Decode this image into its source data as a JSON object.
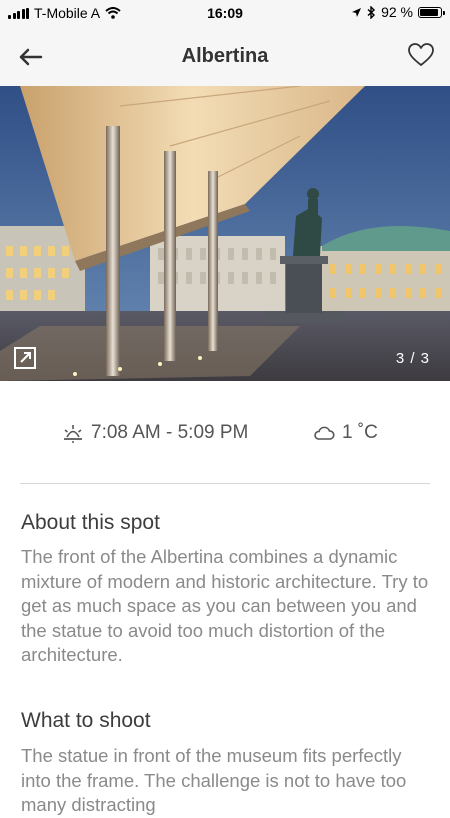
{
  "status_bar": {
    "carrier": "T-Mobile A",
    "time": "16:09",
    "battery": "92 %",
    "battery_level": 0.92
  },
  "nav": {
    "title": "Albertina"
  },
  "photo": {
    "counter": "3 / 3"
  },
  "info": {
    "sun_times": "7:08 AM - 5:09 PM",
    "temperature": "1 ˚C"
  },
  "about": {
    "title": "About this spot",
    "body": "The front of the Albertina combines a dynamic mixture of modern and historic architecture. Try to get as much space as you can between you and the statue to avoid too much distortion of the architecture."
  },
  "shoot": {
    "title": "What to shoot",
    "body": "The statue in front of the museum fits perfectly into the frame. The challenge is not to have too many distracting"
  },
  "colors": {
    "sky": "#3a5a8c",
    "canopy": "#e8c79a",
    "text_secondary": "#8a8a8a"
  }
}
